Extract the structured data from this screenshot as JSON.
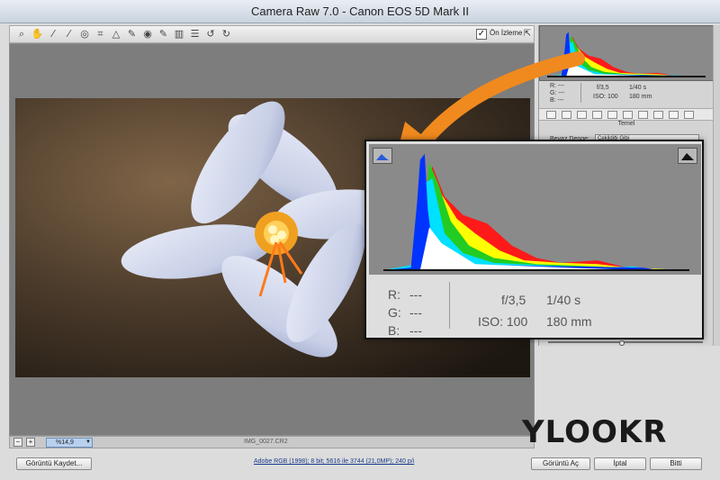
{
  "window": {
    "title": "Camera Raw 7.0  -  Canon EOS 5D Mark II"
  },
  "toolbar": {
    "tools": [
      {
        "name": "zoom-tool-icon",
        "glyph": "⌕"
      },
      {
        "name": "hand-tool-icon",
        "glyph": "✋"
      },
      {
        "name": "white-balance-tool-icon",
        "glyph": "⁄"
      },
      {
        "name": "color-sampler-tool-icon",
        "glyph": "⁄"
      },
      {
        "name": "targeted-adjustment-tool-icon",
        "glyph": "◎"
      },
      {
        "name": "crop-tool-icon",
        "glyph": "⌗"
      },
      {
        "name": "straighten-tool-icon",
        "glyph": "△"
      },
      {
        "name": "spot-removal-tool-icon",
        "glyph": "✎"
      },
      {
        "name": "red-eye-tool-icon",
        "glyph": "◉"
      },
      {
        "name": "adjustment-brush-icon",
        "glyph": "✎"
      },
      {
        "name": "graduated-filter-icon",
        "glyph": "▥"
      },
      {
        "name": "preferences-icon",
        "glyph": "☰"
      },
      {
        "name": "rotate-left-icon",
        "glyph": "↺"
      },
      {
        "name": "rotate-right-icon",
        "glyph": "↻"
      }
    ],
    "preview_checked": "✓",
    "preview_label": "Ön İzleme",
    "fullscreen_glyph": "⇱"
  },
  "status": {
    "zoom_minus": "−",
    "zoom_plus": "+",
    "zoom_value": "%14,9",
    "filename": "IMG_0027.CR2"
  },
  "panel": {
    "mini_r": "R:   ---",
    "mini_g": "G:   ---",
    "mini_b": "B:   ---",
    "mini_aperture": "f/3,5",
    "mini_shutter": "1/40 s",
    "mini_iso": "ISO: 100",
    "mini_focal": "180 mm",
    "section_title": "Temel",
    "wb_label": "Beyaz Denge:",
    "wb_value": "Çekildiği Gibi"
  },
  "callout": {
    "r_label": "R:",
    "r_value": "---",
    "g_label": "G:",
    "g_value": "---",
    "b_label": "B:",
    "b_value": "---",
    "aperture": "f/3,5",
    "shutter": "1/40 s",
    "iso": "ISO: 100",
    "focal": "180 mm"
  },
  "footer": {
    "save_label": "Görüntü Kaydet...",
    "workflow_link": "Adobe RGB (1998); 8 bit; 5616 ile 3744 (21,0MP); 240 p/i",
    "open_label": "Görüntü Aç",
    "cancel_label": "İptal",
    "done_label": "Bitti"
  },
  "watermark": {
    "text": "YLOOKR"
  },
  "colors": {
    "hist_blue": "#0033ff",
    "hist_cyan": "#00e0ff",
    "hist_green": "#22cc22",
    "hist_yellow": "#ffff00",
    "hist_red": "#ff1a1a",
    "hist_magenta": "#ff33ff",
    "arrow": "#f08a1e"
  }
}
